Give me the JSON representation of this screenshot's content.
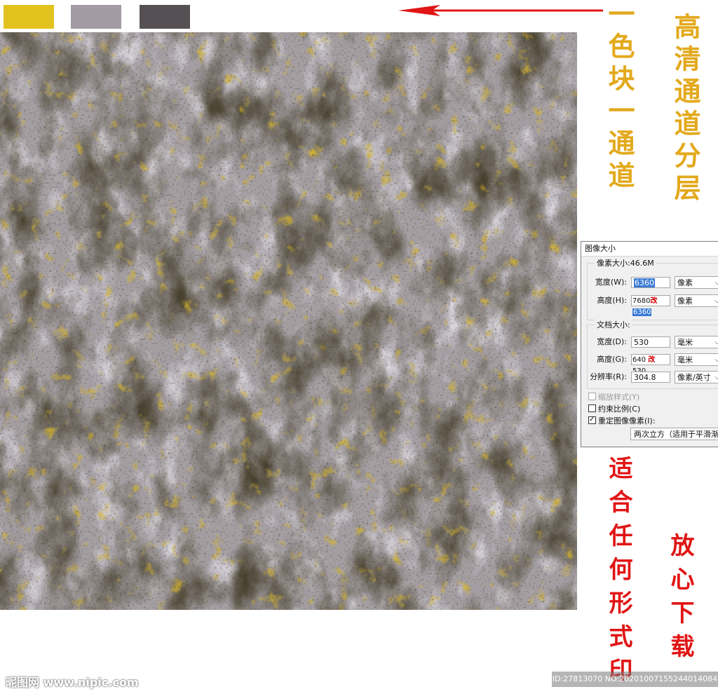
{
  "colors": {
    "swatch_yellow": "#e2c21f",
    "swatch_lilac": "#a39aa6",
    "swatch_dark": "#545054",
    "arrow_red": "#e11515"
  },
  "labels": {
    "color_block_channel": "一色块一通道",
    "hd_channel_layers": "高清通道分层",
    "suitable_any_print": "适合任何形式印",
    "download_freely": "放心下载"
  },
  "dialog": {
    "title": "图像大小",
    "pixel_size": "像素大小:46.6M",
    "width_label": "宽度(W):",
    "width_value": "6360",
    "width_unit": "像素",
    "height_label": "高度(H):",
    "height_value_old": "7680",
    "height_mark": "改",
    "height_value": "6360",
    "height_unit": "像素",
    "doc_size": "文档大小:",
    "doc_width_label": "宽度(D):",
    "doc_width_value": "530",
    "doc_width_unit": "毫米",
    "doc_height_label": "高度(G):",
    "doc_height_value_old": "640",
    "doc_height_mark": "改",
    "doc_height_value": "530",
    "doc_height_unit": "毫米",
    "resolution_label": "分辨率(R):",
    "resolution_value": "304.8",
    "resolution_unit": "像素/英寸",
    "scale_styles": "缩放样式(Y)",
    "constrain": "约束比例(C)",
    "resample": "重定图像像素(I):",
    "resample_method": "两次立方（适用于平滑渐变）"
  },
  "watermark": {
    "site": "昵图网 www.nipic.com",
    "id_line": "ID:27813070 NO:20201007155244014084"
  }
}
